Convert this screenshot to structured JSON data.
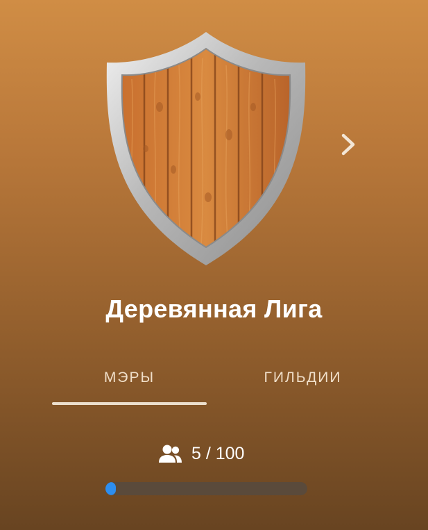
{
  "league": {
    "title": "Деревянная Лига",
    "emblem": "wooden-shield-icon"
  },
  "navigation": {
    "next_icon": "chevron-right-icon"
  },
  "tabs": [
    {
      "label": "МЭРЫ",
      "active": true
    },
    {
      "label": "ГИЛЬДИИ",
      "active": false
    }
  ],
  "members": {
    "icon": "people-icon",
    "text": "5 / 100",
    "current": 5,
    "max": 100
  },
  "progress": {
    "fraction": 0.05,
    "fill_color": "#2d8ef0",
    "track_color": "#5a4a3b"
  },
  "colors": {
    "background_top": "#d08d45",
    "background_bottom": "#684421",
    "tab_indicator": "#ecdfcd"
  }
}
